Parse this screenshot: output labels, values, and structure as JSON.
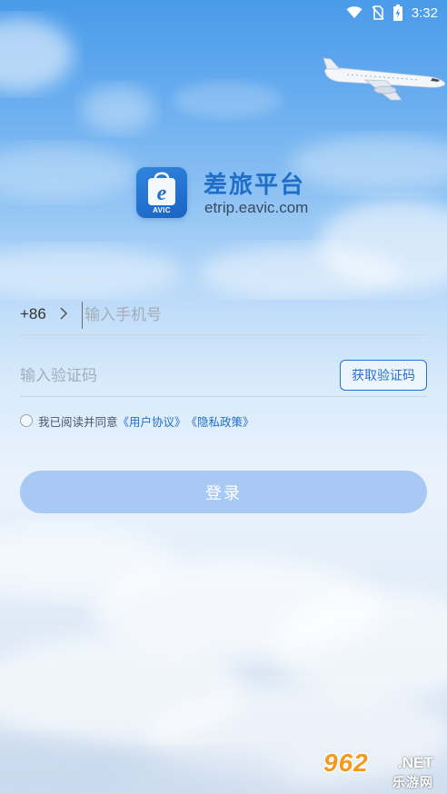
{
  "status_bar": {
    "time": "3:32",
    "icons": [
      "wifi-icon",
      "no-sim-icon",
      "battery-charging-icon"
    ]
  },
  "brand": {
    "logo_caption": "AVIC",
    "title": "差旅平台",
    "domain": "etrip.eavic.com",
    "logo_color": "#1a63c4"
  },
  "login_form": {
    "country_code": "+86",
    "phone_placeholder": "输入手机号",
    "code_placeholder": "输入验证码",
    "get_code_label": "获取验证码",
    "agreement_prefix": "我已阅读并同意",
    "user_agreement_link": "《用户协议》",
    "privacy_policy_link": "《隐私政策》",
    "agreement_checked": false,
    "login_label": "登录"
  },
  "watermark": {
    "number": "962",
    "suffix": ".NET",
    "site_name": "乐游网"
  },
  "colors": {
    "accent": "#1f6fc9",
    "login_button": "#a7c9f4",
    "sky_top": "#4a9bea"
  }
}
